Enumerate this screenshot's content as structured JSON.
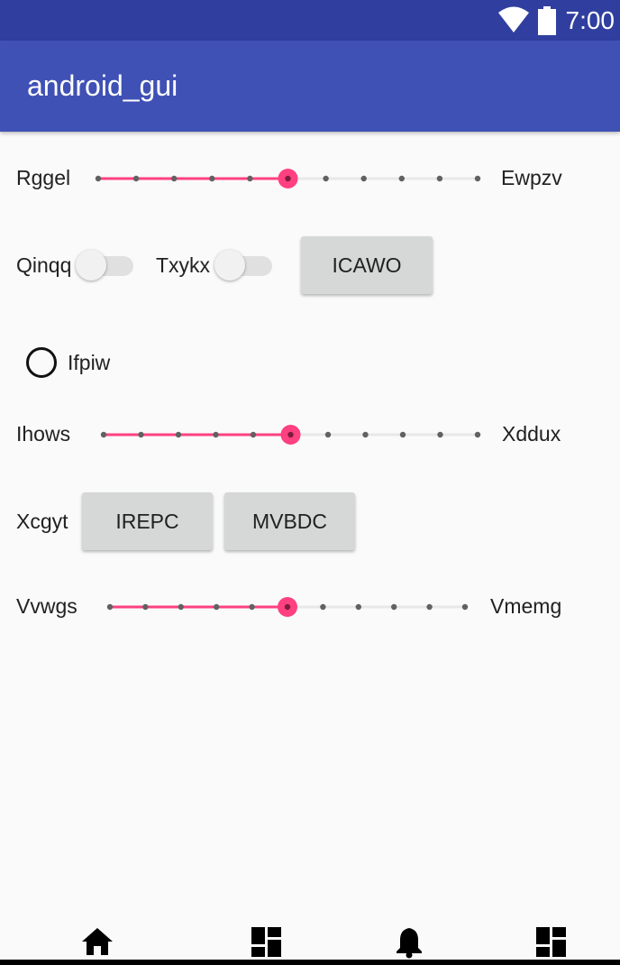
{
  "status_bar": {
    "time": "7:00",
    "icons": [
      "wifi-icon",
      "battery-icon"
    ]
  },
  "app_bar": {
    "title": "android_gui"
  },
  "rows": {
    "seek1": {
      "left_label": "Rggel",
      "right_label": "Ewpzv",
      "value": 5,
      "max": 10
    },
    "switch1": {
      "label": "Qinqq",
      "checked": false
    },
    "switch2": {
      "label": "Txykx",
      "checked": false
    },
    "button_icawo": "ICAWO",
    "radio": {
      "label": "Ifpiw",
      "checked": false
    },
    "seek2": {
      "left_label": "Ihows",
      "right_label": "Xddux",
      "value": 5,
      "max": 10
    },
    "xcgyt_label": "Xcgyt",
    "button_irepc": "IREPC",
    "button_mvbdc": "MVBDC",
    "seek3": {
      "left_label": "Vvwgs",
      "right_label": "Vmemg",
      "value": 5,
      "max": 10
    }
  },
  "bottom_nav": {
    "items": [
      "home-icon",
      "dashboard-icon",
      "notifications-icon",
      "dashboard-icon"
    ]
  },
  "colors": {
    "status_bar": "#303f9f",
    "app_bar": "#3f51b5",
    "accent": "#ff4081",
    "background": "#fafafa",
    "button": "#d6d7d7"
  }
}
